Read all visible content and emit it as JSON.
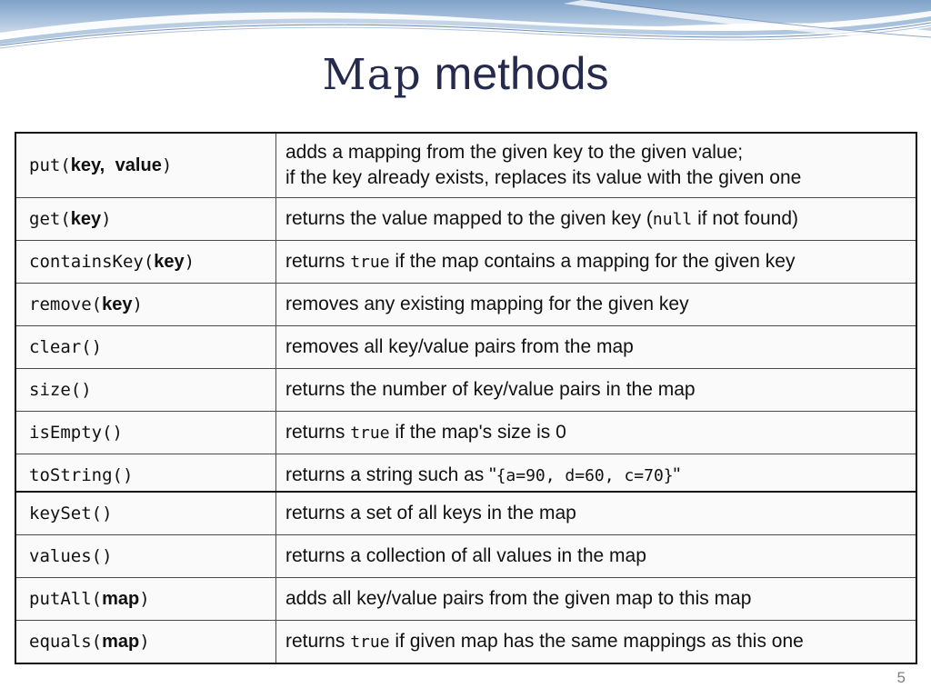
{
  "slide": {
    "title_mono": "Map",
    "title_sans": "methods",
    "page_number": "5",
    "accent_blue": "#8fadd0",
    "accent_blue_deep": "#4a6fa5",
    "title_color": "#262b4d",
    "table_bg": "#fafafa",
    "table_border": "#111111"
  },
  "tables": [
    {
      "id": "core",
      "rows": [
        {
          "signature": {
            "pre": "put(",
            "params": [
              {
                "text": "key,",
                "bold": true
              },
              {
                "text": "value",
                "bold": true
              }
            ],
            "post": ")"
          },
          "description_lines": [
            [
              {
                "text": "adds a mapping from the given key to the given value;",
                "code": false
              }
            ],
            [
              {
                "text": "if the key already exists, replaces its value with the given one",
                "code": false
              }
            ]
          ]
        },
        {
          "signature": {
            "pre": "get(",
            "params": [
              {
                "text": "key",
                "bold": true
              }
            ],
            "post": ")"
          },
          "description_lines": [
            [
              {
                "text": "returns the value mapped to the given key (",
                "code": false
              },
              {
                "text": "null",
                "code": true
              },
              {
                "text": " if not found)",
                "code": false
              }
            ]
          ]
        },
        {
          "signature": {
            "pre": "containsKey(",
            "params": [
              {
                "text": "key",
                "bold": true
              }
            ],
            "post": ")"
          },
          "description_lines": [
            [
              {
                "text": "returns ",
                "code": false
              },
              {
                "text": "true",
                "code": true
              },
              {
                "text": " if the map contains a mapping for the given key",
                "code": false
              }
            ]
          ]
        },
        {
          "signature": {
            "pre": "remove(",
            "params": [
              {
                "text": "key",
                "bold": true
              }
            ],
            "post": ")"
          },
          "description_lines": [
            [
              {
                "text": "removes any existing mapping for the given key",
                "code": false
              }
            ]
          ]
        },
        {
          "signature": {
            "pre": "clear()",
            "params": [],
            "post": ""
          },
          "description_lines": [
            [
              {
                "text": "removes all key/value pairs from the map",
                "code": false
              }
            ]
          ]
        },
        {
          "signature": {
            "pre": "size()",
            "params": [],
            "post": ""
          },
          "description_lines": [
            [
              {
                "text": "returns the number of key/value pairs in the map",
                "code": false
              }
            ]
          ]
        },
        {
          "signature": {
            "pre": "isEmpty()",
            "params": [],
            "post": ""
          },
          "description_lines": [
            [
              {
                "text": "returns ",
                "code": false
              },
              {
                "text": "true",
                "code": true
              },
              {
                "text": " if the map's size is 0",
                "code": false
              }
            ]
          ]
        },
        {
          "signature": {
            "pre": "toString()",
            "params": [],
            "post": ""
          },
          "description_lines": [
            [
              {
                "text": "returns a string such as \"",
                "code": false
              },
              {
                "text": "{a=90, d=60, c=70}",
                "code": true
              },
              {
                "text": "\"",
                "code": false
              }
            ]
          ]
        }
      ]
    },
    {
      "id": "views",
      "rows": [
        {
          "signature": {
            "pre": "keySet()",
            "params": [],
            "post": ""
          },
          "description_lines": [
            [
              {
                "text": "returns a set of all keys in the map",
                "code": false
              }
            ]
          ]
        },
        {
          "signature": {
            "pre": "values()",
            "params": [],
            "post": ""
          },
          "description_lines": [
            [
              {
                "text": "returns a collection of all values in the map",
                "code": false
              }
            ]
          ]
        },
        {
          "signature": {
            "pre": "putAll(",
            "params": [
              {
                "text": "map",
                "bold": true
              }
            ],
            "post": ")"
          },
          "description_lines": [
            [
              {
                "text": "adds all key/value pairs from the given map to this map",
                "code": false
              }
            ]
          ]
        },
        {
          "signature": {
            "pre": "equals(",
            "params": [
              {
                "text": "map",
                "bold": true
              }
            ],
            "post": ")"
          },
          "description_lines": [
            [
              {
                "text": "returns ",
                "code": false
              },
              {
                "text": "true",
                "code": true
              },
              {
                "text": " if given map has the same mappings as this one",
                "code": false
              }
            ]
          ]
        }
      ]
    }
  ]
}
